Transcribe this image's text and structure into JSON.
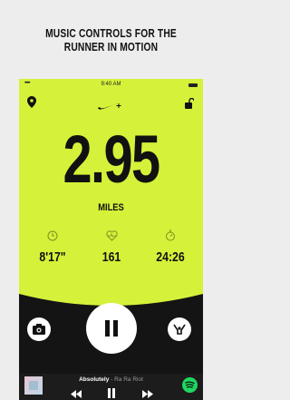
{
  "headline": {
    "line1": "MUSIC CONTROLS FOR THE",
    "line2": "RUNNER IN MOTION"
  },
  "status_bar": {
    "signal": "•••••",
    "time": "9:40 AM"
  },
  "run": {
    "distance": "2.95",
    "unit": "MILES",
    "pace": "8'17\"",
    "heart_rate": "161",
    "duration": "24:26"
  },
  "music": {
    "song": "Absolutely",
    "separator": " - ",
    "artist": "Ra Ra Riot"
  },
  "colors": {
    "accent": "#d6f13a",
    "dark": "#141414",
    "spotify": "#1ed760",
    "background": "#ededed"
  },
  "icons": [
    "location-pin-icon",
    "nike-plus-icon",
    "unlock-icon",
    "clock-icon",
    "heart-rate-icon",
    "stopwatch-icon",
    "camera-icon",
    "pause-icon",
    "cheer-icon",
    "rewind-icon",
    "fast-forward-icon",
    "spotify-icon"
  ]
}
